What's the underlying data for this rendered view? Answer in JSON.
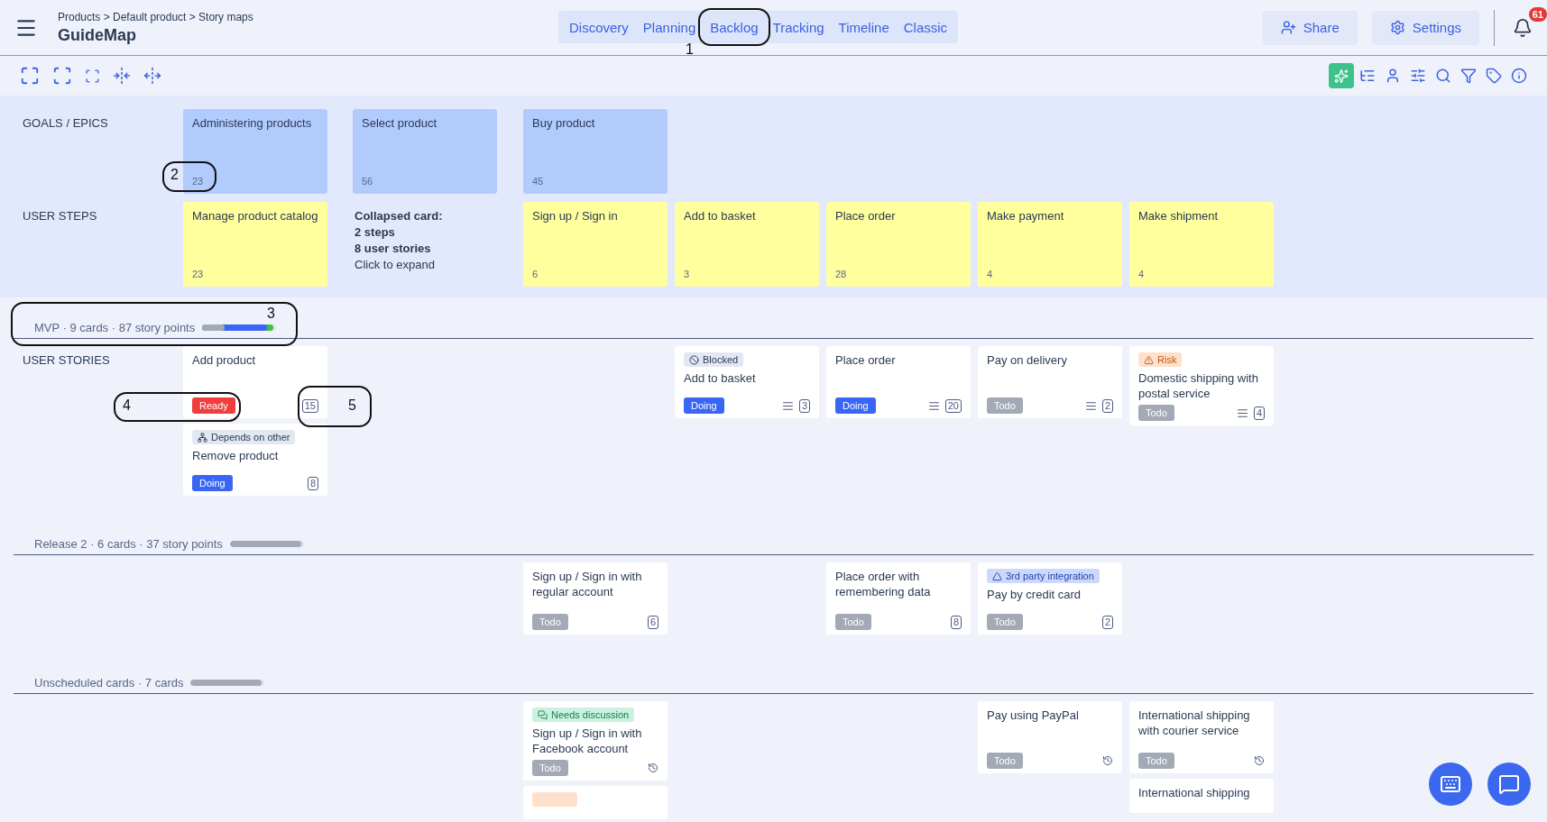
{
  "header": {
    "breadcrumb": "Products > Default product > Story maps",
    "title": "GuideMap",
    "tabs": [
      {
        "label": "Discovery"
      },
      {
        "label": "Planning"
      },
      {
        "label": "Backlog"
      },
      {
        "label": "Tracking"
      },
      {
        "label": "Timeline"
      },
      {
        "label": "Classic"
      }
    ],
    "actions": [
      {
        "kind": "share",
        "label": "Share"
      },
      {
        "kind": "settings",
        "label": "Settings"
      }
    ],
    "notifications": "61"
  },
  "map": {
    "goals_label": "GOALS / EPICS",
    "goals": [
      {
        "title": "Administering products",
        "count": "23"
      },
      {
        "title": "Select product",
        "count": "56"
      },
      {
        "title": "Buy product",
        "count": "45"
      }
    ],
    "steps_label": "USER STEPS",
    "steps": [
      {
        "kind": "step",
        "title": "Manage product catalog",
        "count": "23"
      },
      {
        "kind": "collapsed",
        "lines": [
          "Collapsed card:",
          "2 steps",
          "8 user stories"
        ],
        "hint": "Click to expand"
      },
      {
        "kind": "step",
        "title": "Sign up / Sign in",
        "count": "6"
      },
      {
        "kind": "step",
        "title": "Add to basket",
        "count": "3"
      },
      {
        "kind": "step",
        "title": "Place order",
        "count": "28"
      },
      {
        "kind": "step",
        "title": "Make payment",
        "count": "4"
      },
      {
        "kind": "step",
        "title": "Make shipment",
        "count": "4"
      }
    ]
  },
  "releases": [
    {
      "name": "MVP",
      "summary": " · 9 cards · 87 story points",
      "row_label": "USER STORIES",
      "progress": [
        {
          "color": "#a3aab6",
          "level": 0.3
        },
        {
          "color": "#3a66f5",
          "level": 0.88
        },
        {
          "color": "#3fbf3f",
          "level": 0.96
        }
      ],
      "columns": [
        {
          "cards": [
            {
              "title": "Add product",
              "status": "Ready",
              "points": "15"
            },
            {
              "tag": {
                "kind": "depends",
                "label": "Depends on other"
              },
              "title": "Remove product",
              "status": "Doing",
              "points": "8"
            }
          ]
        },
        {},
        {},
        {
          "cards": [
            {
              "tag": {
                "kind": "blocked",
                "label": "Blocked"
              },
              "title": "Add to basket",
              "status": "Doing",
              "description": true,
              "points": "3"
            }
          ]
        },
        {
          "cards": [
            {
              "title": "Place order",
              "status": "Doing",
              "description": true,
              "points": "20"
            }
          ]
        },
        {
          "cards": [
            {
              "title": "Pay on delivery",
              "status": "Todo",
              "description": true,
              "points": "2"
            }
          ]
        },
        {
          "cards": [
            {
              "tag": {
                "kind": "risk",
                "label": "Risk"
              },
              "title": "Domestic shipping with postal service",
              "status": "Todo",
              "description": true,
              "points": "4"
            }
          ]
        }
      ]
    },
    {
      "name": "Release 2",
      "summary": " · 6 cards · 37 story points",
      "progress": [
        {
          "color": "#a3aab6",
          "level": 0.96
        }
      ],
      "columns": [
        {},
        {},
        {
          "cards": [
            {
              "title": "Sign up / Sign in with regular account",
              "status": "Todo",
              "points": "6"
            }
          ]
        },
        {},
        {
          "cards": [
            {
              "title": "Place order with remembering data",
              "status": "Todo",
              "points": "8"
            }
          ]
        },
        {
          "cards": [
            {
              "tag": {
                "kind": "integration",
                "label": "3rd party integration"
              },
              "title": "Pay by credit card",
              "status": "Todo",
              "points": "2"
            }
          ]
        },
        {}
      ]
    },
    {
      "name": "Unscheduled cards",
      "summary": " · 7 cards",
      "progress": [
        {
          "color": "#a3aab6",
          "level": 0.96
        }
      ],
      "columns": [
        {},
        {},
        {
          "cards": [
            {
              "tag": {
                "kind": "discussion",
                "label": "Needs discussion"
              },
              "title": "Sign up / Sign in with Facebook account",
              "status": "Todo",
              "history": true
            },
            {
              "tag": {
                "kind": "risk"
              }
            }
          ]
        },
        {},
        {},
        {
          "cards": [
            {
              "title": "Pay using PayPal",
              "status": "Todo",
              "history": true
            }
          ]
        },
        {
          "cards": [
            {
              "title": "International shipping with courier service",
              "status": "Todo",
              "history": true
            },
            {
              "title": "International shipping"
            }
          ]
        }
      ]
    }
  ],
  "callouts": [
    {
      "number": "1"
    },
    {
      "number": "2"
    },
    {
      "number": "3"
    },
    {
      "number": "4"
    },
    {
      "number": "5"
    }
  ]
}
